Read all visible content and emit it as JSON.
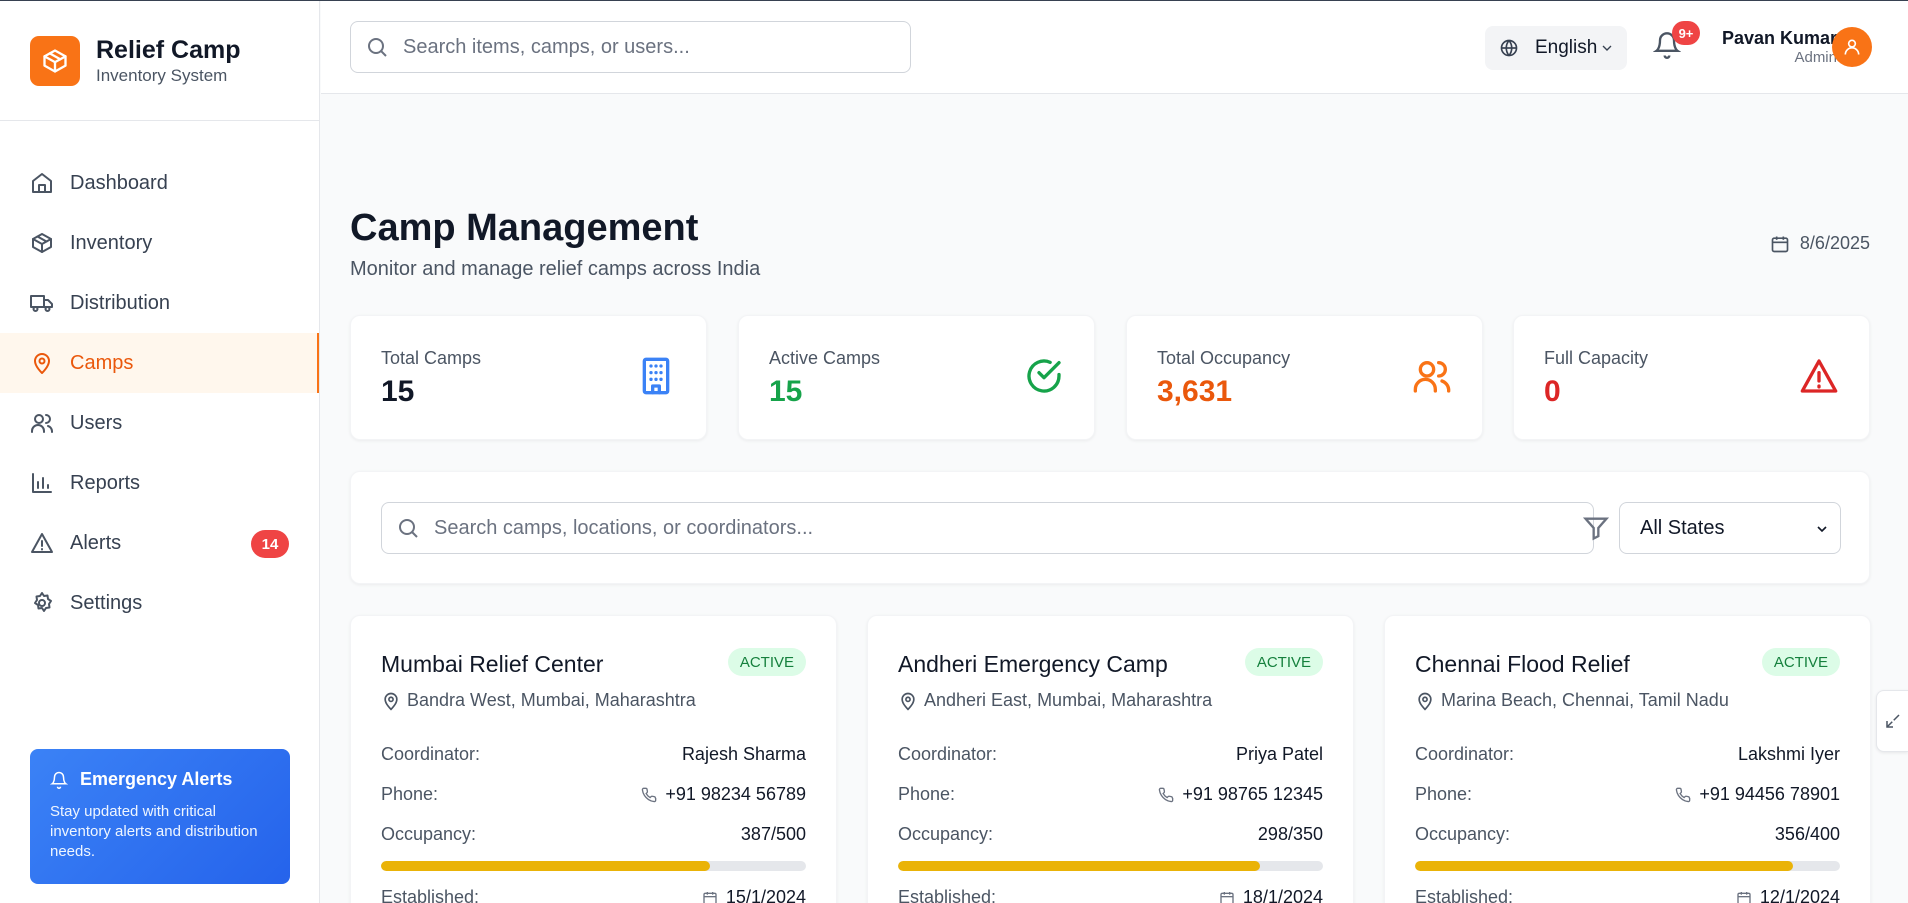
{
  "brand": {
    "title": "Relief Camp",
    "subtitle": "Inventory System"
  },
  "sidebar": {
    "items": [
      {
        "label": "Dashboard",
        "icon": "home-icon"
      },
      {
        "label": "Inventory",
        "icon": "package-icon"
      },
      {
        "label": "Distribution",
        "icon": "truck-icon"
      },
      {
        "label": "Camps",
        "icon": "map-pin-icon",
        "active": true
      },
      {
        "label": "Users",
        "icon": "users-icon"
      },
      {
        "label": "Reports",
        "icon": "bar-chart-icon"
      },
      {
        "label": "Alerts",
        "icon": "alert-triangle-icon",
        "badge": "14"
      },
      {
        "label": "Settings",
        "icon": "gear-icon"
      }
    ],
    "promo": {
      "title": "Emergency Alerts",
      "text": "Stay updated with critical inventory alerts and distribution needs."
    }
  },
  "header": {
    "search_placeholder": "Search items, camps, or users...",
    "language": "English",
    "notifications_badge": "9+",
    "user_name": "Pavan Kumar",
    "user_role": "Admin"
  },
  "page": {
    "title": "Camp Management",
    "subtitle": "Monitor and manage relief camps across India",
    "date": "8/6/2025"
  },
  "stats": [
    {
      "label": "Total Camps",
      "value": "15",
      "color": "#111827",
      "icon": "building-icon"
    },
    {
      "label": "Active Camps",
      "value": "15",
      "color": "#16a34a",
      "icon": "check-circle-icon"
    },
    {
      "label": "Total Occupancy",
      "value": "3,631",
      "color": "#ea580c",
      "icon": "users-icon"
    },
    {
      "label": "Full Capacity",
      "value": "0",
      "color": "#dc2626",
      "icon": "alert-triangle-icon"
    }
  ],
  "filters": {
    "search_placeholder": "Search camps, locations, or coordinators...",
    "state_selected": "All States"
  },
  "labels": {
    "coordinator": "Coordinator:",
    "phone": "Phone:",
    "occupancy": "Occupancy:",
    "established": "Established:"
  },
  "camps": [
    {
      "name": "Mumbai Relief Center",
      "status": "ACTIVE",
      "location": "Bandra West, Mumbai, Maharashtra",
      "coordinator": "Rajesh Sharma",
      "phone": "+91 98234 56789",
      "occupancy": "387/500",
      "occupancy_ratio": 0.774,
      "established": "15/1/2024"
    },
    {
      "name": "Andheri Emergency Camp",
      "status": "ACTIVE",
      "location": "Andheri East, Mumbai, Maharashtra",
      "coordinator": "Priya Patel",
      "phone": "+91 98765 12345",
      "occupancy": "298/350",
      "occupancy_ratio": 0.851,
      "established": "18/1/2024"
    },
    {
      "name": "Chennai Flood Relief",
      "status": "ACTIVE",
      "location": "Marina Beach, Chennai, Tamil Nadu",
      "coordinator": "Lakshmi Iyer",
      "phone": "+91 94456 78901",
      "occupancy": "356/400",
      "occupancy_ratio": 0.89,
      "established": "12/1/2024"
    }
  ],
  "colors": {
    "brand": "#f97316",
    "active_nav": "#ea580c",
    "progress": "#eab308",
    "alert_badge": "#ef4444"
  }
}
